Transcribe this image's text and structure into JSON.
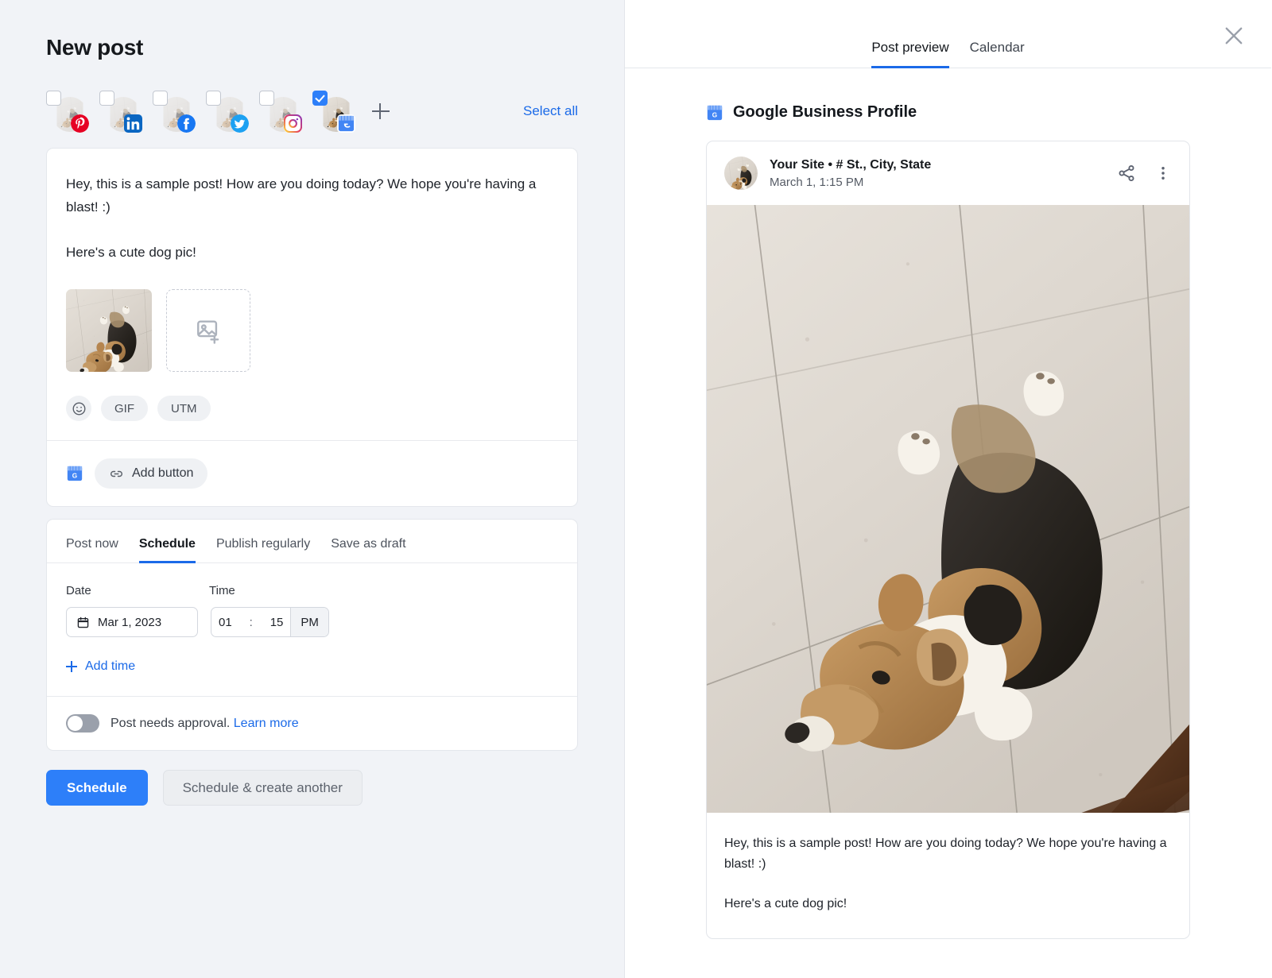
{
  "left": {
    "title": "New post",
    "accounts": [
      {
        "platform": "pinterest",
        "checked": false
      },
      {
        "platform": "linkedin",
        "checked": false
      },
      {
        "platform": "facebook",
        "checked": false
      },
      {
        "platform": "twitter",
        "checked": false
      },
      {
        "platform": "instagram",
        "checked": false
      },
      {
        "platform": "google-business-profile",
        "checked": true
      }
    ],
    "add_account_icon": "plus-icon",
    "select_all": "Select all",
    "composer": {
      "paragraph1": "Hey, this is a sample post! How are you doing today? We hope you're having a blast! :)",
      "paragraph2": "Here's a cute dog pic!",
      "attached_image_alt": "corgi-photo-thumbnail",
      "add_image_icon": "add-image-icon",
      "chips": [
        {
          "name": "emoji",
          "label": "☺",
          "icon": "emoji-icon"
        },
        {
          "name": "gif",
          "label": "GIF",
          "icon": null
        },
        {
          "name": "utm",
          "label": "UTM",
          "icon": null
        }
      ]
    },
    "add_button_row": {
      "account_icon": "google-business-profile-icon",
      "link_icon": "link-icon",
      "label": "Add button"
    },
    "schedule_tabs": [
      {
        "label": "Post now",
        "active": false
      },
      {
        "label": "Schedule",
        "active": true
      },
      {
        "label": "Publish regularly",
        "active": false
      },
      {
        "label": "Save as draft",
        "active": false
      }
    ],
    "schedule": {
      "date_label": "Date",
      "time_label": "Time",
      "date_value": "Mar 1, 2023",
      "calendar_icon": "calendar-icon",
      "time_hour": "01",
      "time_separator": ":",
      "time_minute": "15",
      "time_ampm": "PM",
      "add_time_label": "Add time",
      "add_time_icon": "plus-icon"
    },
    "approval": {
      "enabled": false,
      "text": "Post needs approval.",
      "link": "Learn more"
    },
    "actions": {
      "primary": "Schedule",
      "secondary": "Schedule & create another"
    }
  },
  "right": {
    "tabs": [
      {
        "label": "Post preview",
        "active": true
      },
      {
        "label": "Calendar",
        "active": false
      }
    ],
    "close_icon": "close-icon",
    "preview": {
      "platform_icon": "google-business-profile-icon",
      "platform_name": "Google Business Profile",
      "avatar_alt": "corgi-photo-avatar",
      "account_name": "Your Site • # St., City, State",
      "timestamp": "March 1, 1:15 PM",
      "share_icon": "share-icon",
      "more_icon": "more-vertical-icon",
      "photo_alt": "corgi-lying-on-tile-floor",
      "caption1": "Hey, this is a sample post! How are you doing today? We hope you're having a blast! :)",
      "caption2": "Here's a cute dog pic!"
    }
  },
  "colors": {
    "accent": "#2d7ff9",
    "link": "#1b6ae8",
    "panel_bg": "#f1f3f7",
    "pinterest": "#e60023",
    "linkedin": "#0a66c2",
    "facebook": "#1877f2",
    "twitter": "#1da1f2",
    "instagram": "#e4405f",
    "gbp_blue": "#4285f4"
  }
}
